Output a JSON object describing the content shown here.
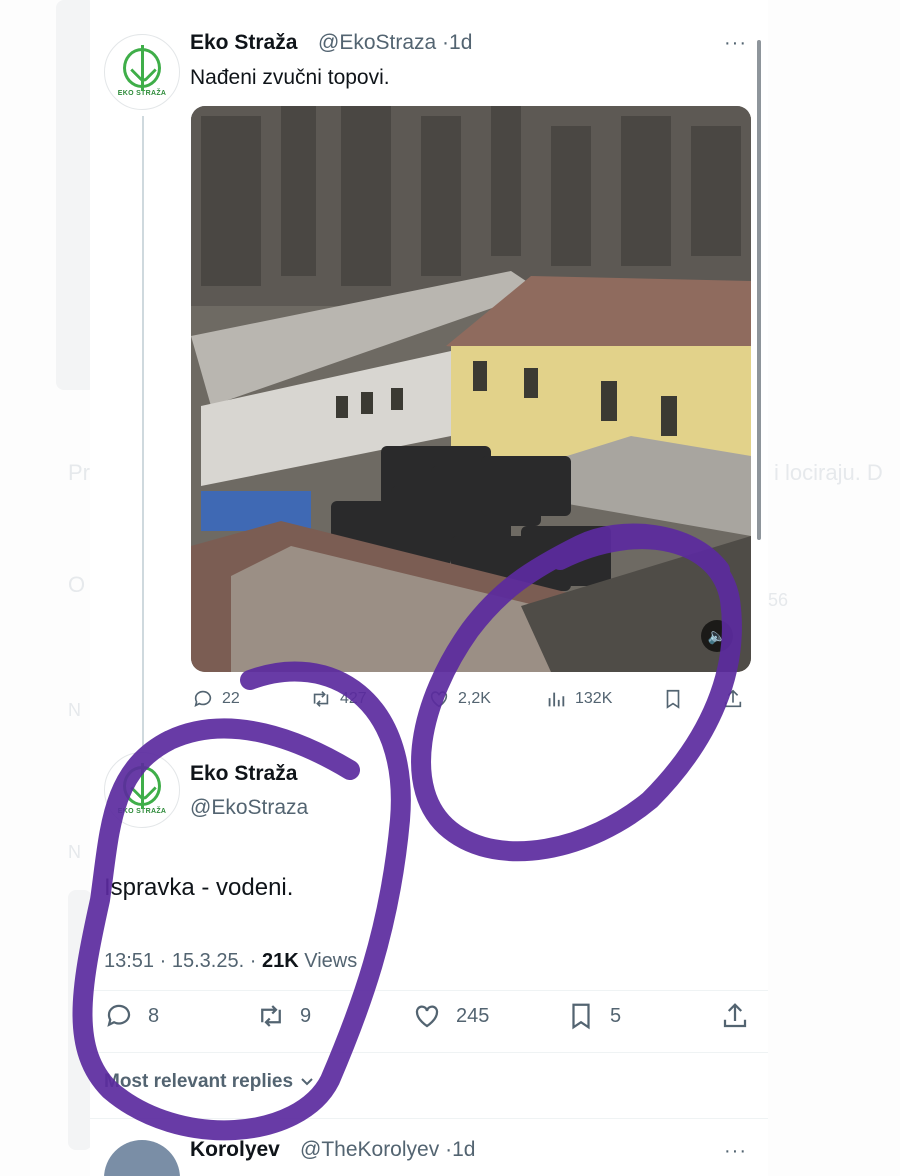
{
  "background_ghost": {
    "line1": "Pr",
    "line2": "O",
    "line3": "i lociraju. D",
    "line4": "N",
    "line5": "N",
    "count": "56"
  },
  "tweet": {
    "author": "Eko Straža",
    "handle": "@EkoStraza",
    "separator": "·",
    "age": "1d",
    "text": "Nađeni zvučni topovi.",
    "avatar_text": "EKO STRAŽA",
    "actions": {
      "replies": "22",
      "retweets": "427",
      "likes": "2,2K",
      "views": "132K"
    }
  },
  "reply_main": {
    "author": "Eko Straža",
    "handle": "@EkoStraza",
    "avatar_text": "EKO STRAŽA",
    "text": "Ispravka - vodeni.",
    "time": "13:51",
    "dot": "·",
    "date": "15.3.25.",
    "views_count": "21K",
    "views_label": "Views",
    "actions": {
      "replies": "8",
      "retweets": "9",
      "likes": "245",
      "bookmarks": "5"
    }
  },
  "replies_filter": {
    "label": "Most relevant replies"
  },
  "next_reply": {
    "author": "Korolyev",
    "handle": "@TheKorolyev",
    "separator": "·",
    "age": "1d"
  },
  "more_label": "···",
  "colors": {
    "accent_annotation": "#5b2a9e",
    "logo_green": "#3fae49",
    "secondary_text": "#536471"
  },
  "icons": [
    "reply-icon",
    "retweet-icon",
    "like-icon",
    "views-icon",
    "bookmark-icon",
    "share-icon",
    "sound-icon",
    "chevron-down-icon"
  ]
}
